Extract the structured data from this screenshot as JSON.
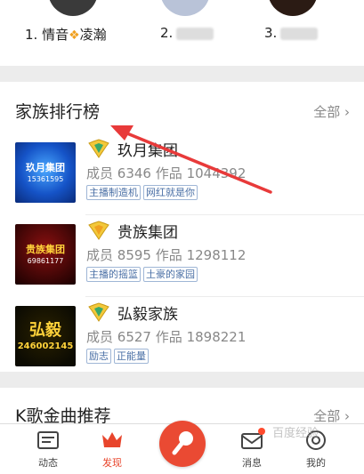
{
  "top_users": [
    {
      "rank_label": "1.",
      "name_a": "情音",
      "name_b": "凌瀚",
      "avatar_color": "#3a3a3a"
    },
    {
      "rank_label": "2.",
      "name_a": "",
      "name_b": "",
      "avatar_color": "#b9c3d8"
    },
    {
      "rank_label": "3.",
      "name_a": "",
      "name_b": "",
      "avatar_color": "#2b1b14"
    }
  ],
  "family_section": {
    "title": "家族排行榜",
    "see_all": "全部",
    "families": [
      {
        "name": "玖月集团",
        "members_label": "成员",
        "members": "6346",
        "works_label": "作品",
        "works": "1044392",
        "tags": [
          "主播制造机",
          "网红就是你"
        ],
        "thumb_text": "玖月集团",
        "thumb_sub": "15361595"
      },
      {
        "name": "贵族集团",
        "members_label": "成员",
        "members": "8595",
        "works_label": "作品",
        "works": "1298112",
        "tags": [
          "主播的摇篮",
          "土豪的家园"
        ],
        "thumb_text": "贵族集团",
        "thumb_sub": "69861177"
      },
      {
        "name": "弘毅家族",
        "members_label": "成员",
        "members": "6527",
        "works_label": "作品",
        "works": "1898221",
        "tags": [
          "励志",
          "正能量"
        ],
        "thumb_text": "弘毅",
        "thumb_sub": "246002145"
      }
    ]
  },
  "ksong_section": {
    "title": "K歌金曲推荐",
    "see_all": "全部"
  },
  "tabbar": {
    "tabs": [
      {
        "label": "动态",
        "active": false
      },
      {
        "label": "发现",
        "active": true
      },
      {
        "label": "消息",
        "active": false
      },
      {
        "label": "我的",
        "active": false
      }
    ]
  },
  "watermark": "百度经验",
  "colors": {
    "accent": "#e8452c",
    "annotation_arrow": "#e83a3a",
    "tag_border": "#9fb6d6",
    "tag_text": "#4a6fa5"
  }
}
